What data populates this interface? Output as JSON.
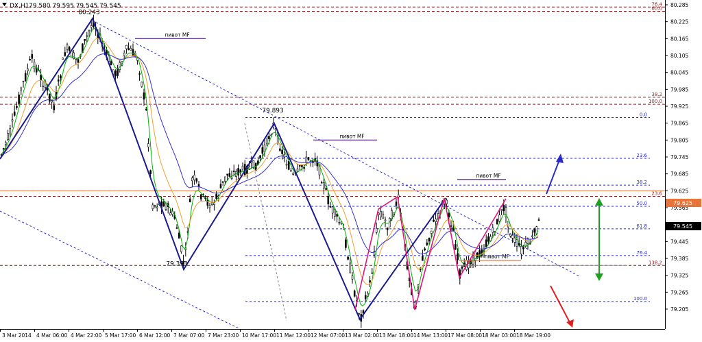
{
  "header": {
    "symbol_label": "DX,H1",
    "ohlc_label": "79.580 79.595 79.545 79.545"
  },
  "chart_data": {
    "type": "candlestick",
    "symbol": "DX",
    "timeframe": "H1",
    "ohlc": {
      "open": 79.58,
      "high": 79.595,
      "low": 79.545,
      "close": 79.545
    },
    "ylim": [
      79.205,
      80.285
    ],
    "y_ticks": [
      "80.285",
      "80.225",
      "80.165",
      "80.105",
      "80.045",
      "79.985",
      "79.925",
      "79.865",
      "79.805",
      "79.745",
      "79.685",
      "79.625",
      "79.565",
      "79.505",
      "79.445",
      "79.385",
      "79.325",
      "79.265",
      "79.205"
    ],
    "x_ticks": [
      "3 Mar 2014",
      "4 Mar 06:00",
      "4 Mar 22:00",
      "5 Mar 17:00",
      "6 Mar 12:00",
      "7 Mar 07:00",
      "7 Mar 23:00",
      "10 Mar 17:00",
      "11 Mar 12:00",
      "12 Mar 07:00",
      "13 Mar 02:00",
      "13 Mar 18:00",
      "14 Mar 13:00",
      "17 Mar 08:00",
      "18 Mar 03:00",
      "18 Mar 19:00"
    ],
    "price_label": {
      "value": "79.545",
      "color": "#000000"
    },
    "level_label": {
      "value": "79.625",
      "color": "#e8743b"
    },
    "horizontal_level": 79.625,
    "price_annotations": [
      {
        "text": "80.243",
        "x": 130,
        "y": 80.243
      },
      {
        "text": "79.893",
        "x": 398,
        "y": 79.893
      },
      {
        "text": "79.393",
        "x": 258,
        "y": 79.393
      }
    ],
    "pivot_labels": [
      {
        "text": "пивот MF",
        "x_from": 197,
        "x_to": 300,
        "y": 80.165
      },
      {
        "text": "пивот MF",
        "x_from": 457,
        "x_to": 550,
        "y": 79.805
      },
      {
        "text": "пивот MF",
        "x_from": 667,
        "x_to": 738,
        "y": 79.665
      },
      {
        "text": "пивот MF",
        "x_from": 670,
        "x_to": 760,
        "y": 79.378
      }
    ],
    "fibo_right": [
      {
        "label": "76.4",
        "y": 80.277
      },
      {
        "label": "60.0",
        "y": 80.262
      },
      {
        "label": "38.2",
        "y": 79.957
      },
      {
        "label": "100.0",
        "y": 79.932
      },
      {
        "label": "23.6",
        "y": 79.605
      },
      {
        "label": "138.2",
        "y": 79.36
      }
    ],
    "fibo_mid": [
      {
        "label": "0.0",
        "y": 79.885
      },
      {
        "label": "23.6",
        "y": 79.74
      },
      {
        "label": "38.2",
        "y": 79.645
      },
      {
        "label": "50.0",
        "y": 79.57
      },
      {
        "label": "61.8",
        "y": 79.49
      },
      {
        "label": "76.4",
        "y": 79.395
      },
      {
        "label": "100.0",
        "y": 79.232
      }
    ],
    "arrows": [
      "up-blue",
      "down-red",
      "double-green"
    ]
  }
}
